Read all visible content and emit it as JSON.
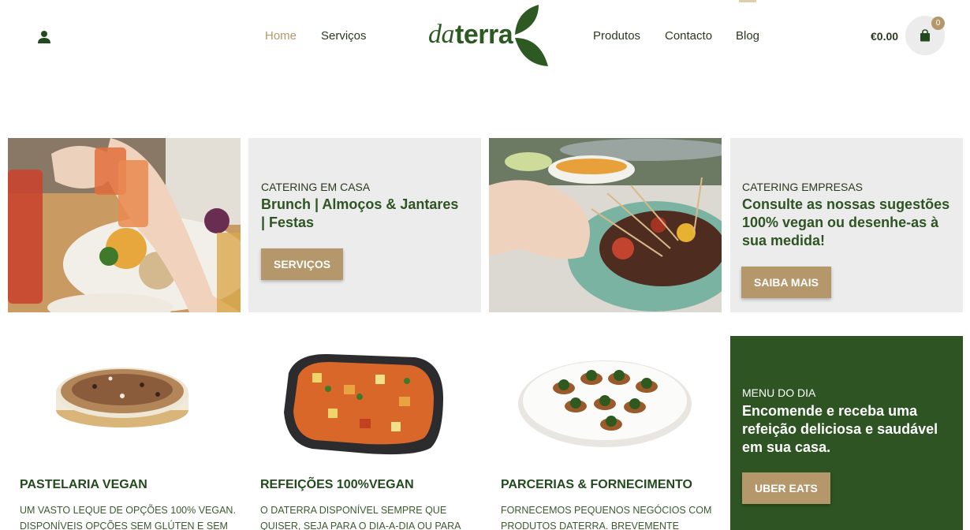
{
  "nav": {
    "home": "Home",
    "servicos": "Serviços",
    "produtos": "Produtos",
    "contacto": "Contacto",
    "blog": "Blog"
  },
  "logo": {
    "part1": "da",
    "part2": "terra"
  },
  "cart": {
    "total": "€0.00",
    "count": "0"
  },
  "tiles": {
    "catering_casa": {
      "kicker": "CATERING EM CASA",
      "heading": "Brunch | Almoços & Jantares | Festas",
      "button": "SERVIÇOS"
    },
    "catering_empresas": {
      "kicker": "CATERING EMPRESAS",
      "heading": "Consulte as nossas sugestões 100% vegan ou desenhe-as à sua medida!",
      "button": "SAIBA MAIS"
    },
    "menu_dia": {
      "kicker": "MENU DO DIA",
      "heading": "Encomende e receba uma refeição deliciosa e saudável em sua casa.",
      "button": "UBER EATS"
    }
  },
  "products": [
    {
      "title": "PASTELARIA VEGAN",
      "line1": "UM VASTO LEQUE DE OPÇÕES 100% VEGAN.",
      "line2": "DISPONÍVEIS OPÇÕES SEM GLÚTEN E SEM"
    },
    {
      "title": "REFEIÇÕES 100%VEGAN",
      "line1": "O DATERRA DISPONÍVEL SEMPRE QUE",
      "line2": "QUISER, SEJA PARA O DIA-A-DIA OU PARA"
    },
    {
      "title": "PARCERIAS & FORNECIMENTO",
      "line1": "FORNECEMOS PEQUENOS NEGÓCIOS COM",
      "line2": "PRODUTOS DATERRA. BREVEMENTE"
    }
  ],
  "colors": {
    "brand_green": "#2d5422",
    "accent_gold": "#b4976a",
    "tile_gray": "#ececec"
  },
  "icons": [
    "user-icon",
    "shopping-bag-icon",
    "leaf-icon"
  ]
}
